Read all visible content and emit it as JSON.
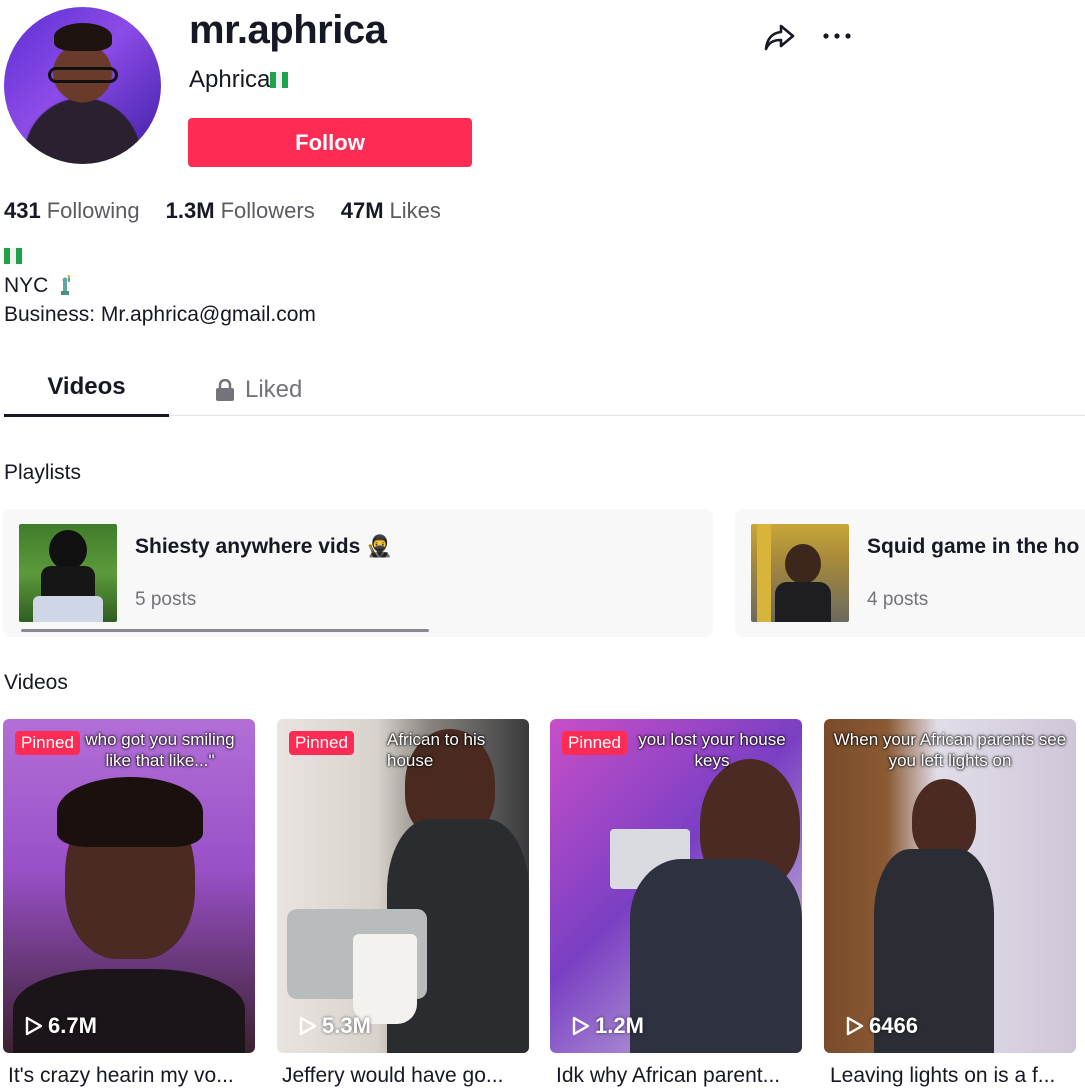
{
  "profile": {
    "username": "mr.aphrica",
    "nickname": "Aphrica",
    "follow_label": "Follow"
  },
  "stats": [
    {
      "value": "431",
      "label": "Following"
    },
    {
      "value": "1.3M",
      "label": "Followers"
    },
    {
      "value": "47M",
      "label": "Likes"
    }
  ],
  "bio": {
    "line1": "NYC",
    "line2": "Business: Mr.aphrica@gmail.com"
  },
  "tabs": {
    "videos": "Videos",
    "liked": "Liked"
  },
  "playlists": {
    "title": "Playlists",
    "items": [
      {
        "name": "Shiesty anywhere vids 🥷",
        "count": "5 posts"
      },
      {
        "name": "Squid game in the ho",
        "count": "4 posts"
      }
    ]
  },
  "videos": {
    "title": "Videos",
    "items": [
      {
        "pinned": "Pinned",
        "overlay": "who got you smiling like that like...\"",
        "views": "6.7M",
        "caption": "It's crazy hearin my vo..."
      },
      {
        "pinned": "Pinned",
        "overlay": "African to his house",
        "views": "5.3M",
        "caption": "Jeffery would have go..."
      },
      {
        "pinned": "Pinned",
        "overlay": "you lost your house keys",
        "views": "1.2M",
        "caption": "Idk why African parent..."
      },
      {
        "pinned": "",
        "overlay": "When your African parents see you left lights on",
        "views": "6466",
        "caption": "Leaving lights on is a f..."
      }
    ]
  },
  "colors": {
    "accent": "#fe2c55",
    "text": "#161823",
    "muted": "#73747b"
  }
}
